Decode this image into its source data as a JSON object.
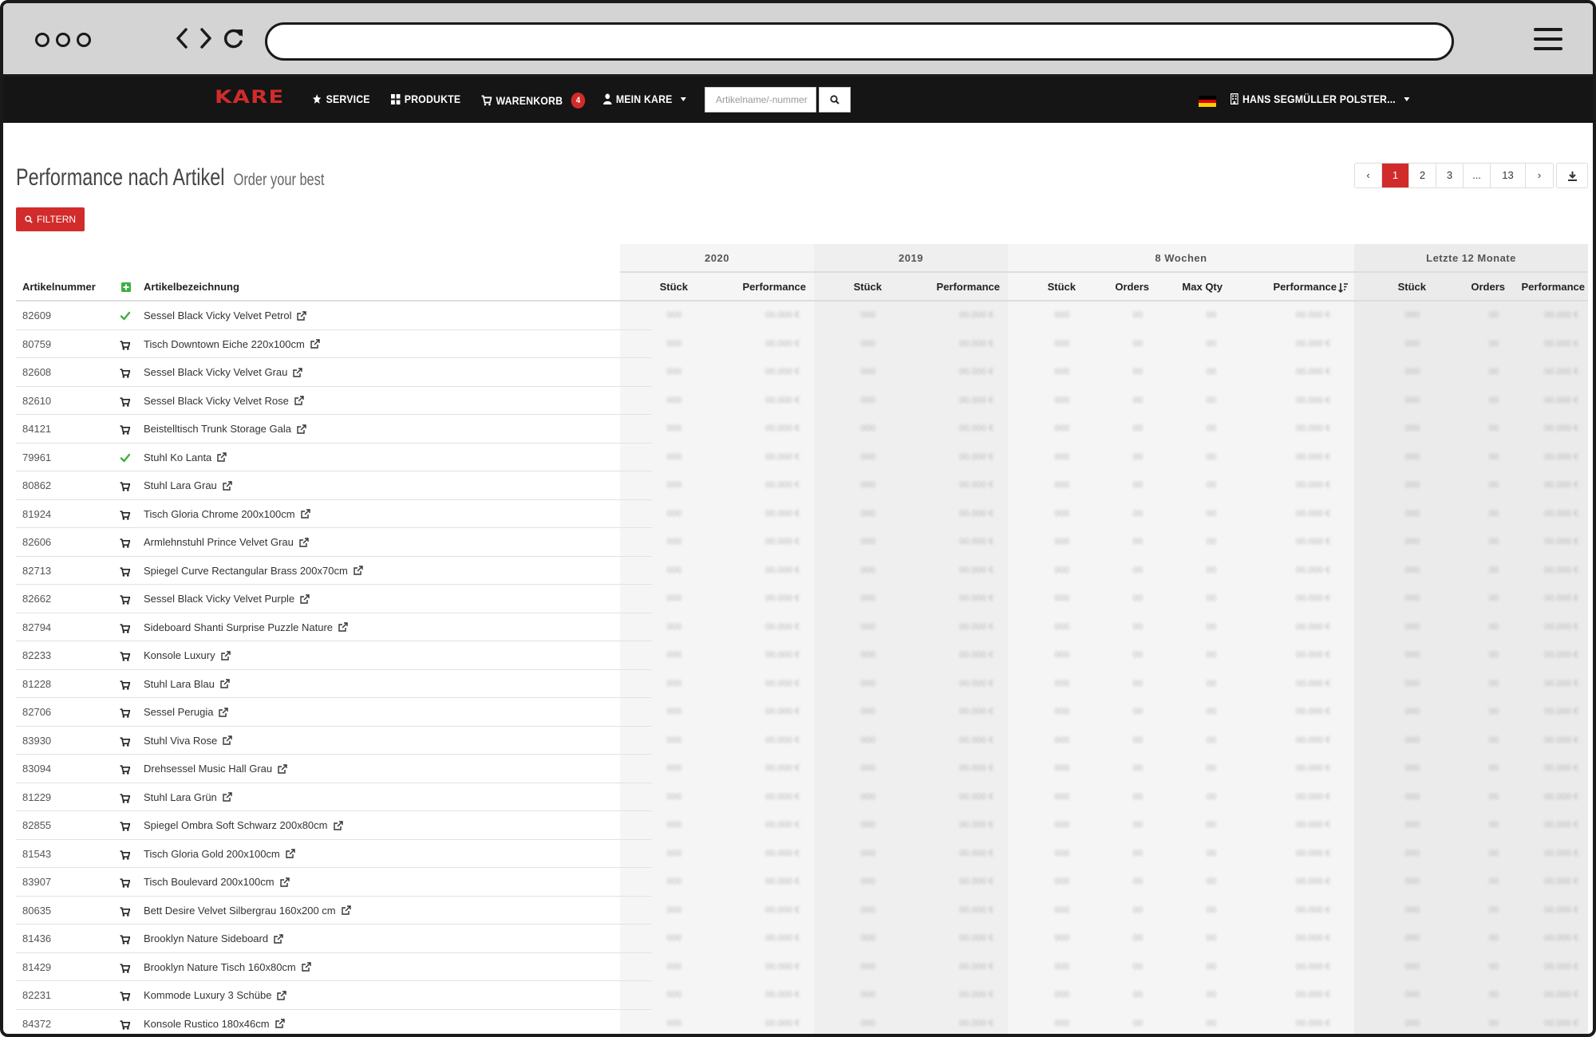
{
  "browser": {
    "url": "",
    "icons": [
      "window-dots",
      "back-icon",
      "forward-icon",
      "reload-icon",
      "hamburger-icon"
    ]
  },
  "nav": {
    "logo": "KARE",
    "service": "SERVICE",
    "produkte": "PRODUKTE",
    "warenkorb": "WARENKORB",
    "cart_count": "4",
    "mein_kare": "MEIN KARE",
    "search_placeholder": "Artikelname/-nummer",
    "account": "HANS SEGMÜLLER POLSTER...",
    "accent_color": "#d22b2b"
  },
  "page": {
    "title": "Performance nach Artikel",
    "subtitle": "Order your best",
    "filter_label": "FILTERN"
  },
  "pager": {
    "prev": "‹",
    "pages": [
      "1",
      "2",
      "3",
      "...",
      "13"
    ],
    "active": "1",
    "next": "›"
  },
  "table": {
    "groups": [
      "2020",
      "2019",
      "8 Wochen",
      "Letzte 12 Monate"
    ],
    "headers": {
      "artikelnummer": "Artikelnummer",
      "artikelbezeichnung": "Artikelbezeichnung",
      "s2020_stueck": "Stück",
      "s2020_perf": "Performance",
      "s2019_stueck": "Stück",
      "s2019_perf": "Performance",
      "w8_stueck": "Stück",
      "w8_orders": "Orders",
      "w8_maxqty": "Max Qty",
      "w8_perf": "Performance",
      "m12_stueck": "Stück",
      "m12_orders": "Orders",
      "m12_perf": "Performance"
    },
    "rows": [
      {
        "nr": "82609",
        "name": "Sessel Black Vicky Velvet Petrol",
        "status": "check"
      },
      {
        "nr": "80759",
        "name": "Tisch Downtown Eiche 220x100cm",
        "status": "cart"
      },
      {
        "nr": "82608",
        "name": "Sessel Black Vicky Velvet Grau",
        "status": "cart"
      },
      {
        "nr": "82610",
        "name": "Sessel Black Vicky Velvet Rose",
        "status": "cart"
      },
      {
        "nr": "84121",
        "name": "Beistelltisch Trunk Storage Gala",
        "status": "cart"
      },
      {
        "nr": "79961",
        "name": "Stuhl Ko Lanta",
        "status": "check"
      },
      {
        "nr": "80862",
        "name": "Stuhl Lara Grau",
        "status": "cart"
      },
      {
        "nr": "81924",
        "name": "Tisch Gloria Chrome 200x100cm",
        "status": "cart"
      },
      {
        "nr": "82606",
        "name": "Armlehnstuhl Prince Velvet Grau",
        "status": "cart"
      },
      {
        "nr": "82713",
        "name": "Spiegel Curve Rectangular Brass 200x70cm",
        "status": "cart"
      },
      {
        "nr": "82662",
        "name": "Sessel Black Vicky Velvet Purple",
        "status": "cart"
      },
      {
        "nr": "82794",
        "name": "Sideboard Shanti Surprise Puzzle Nature",
        "status": "cart"
      },
      {
        "nr": "82233",
        "name": "Konsole Luxury",
        "status": "cart"
      },
      {
        "nr": "81228",
        "name": "Stuhl Lara Blau",
        "status": "cart"
      },
      {
        "nr": "82706",
        "name": "Sessel Perugia",
        "status": "cart"
      },
      {
        "nr": "83930",
        "name": "Stuhl Viva Rose",
        "status": "cart"
      },
      {
        "nr": "83094",
        "name": "Drehsessel Music Hall Grau",
        "status": "cart"
      },
      {
        "nr": "81229",
        "name": "Stuhl Lara Grün",
        "status": "cart"
      },
      {
        "nr": "82855",
        "name": "Spiegel Ombra Soft Schwarz 200x80cm",
        "status": "cart"
      },
      {
        "nr": "81543",
        "name": "Tisch Gloria Gold 200x100cm",
        "status": "cart"
      },
      {
        "nr": "83907",
        "name": "Tisch Boulevard 200x100cm",
        "status": "cart"
      },
      {
        "nr": "80635",
        "name": "Bett Desire Velvet Silbergrau 160x200 cm",
        "status": "cart"
      },
      {
        "nr": "81436",
        "name": "Brooklyn Nature Sideboard",
        "status": "cart"
      },
      {
        "nr": "81429",
        "name": "Brooklyn Nature Tisch 160x80cm",
        "status": "cart"
      },
      {
        "nr": "82231",
        "name": "Kommode Luxury 3 Schübe",
        "status": "cart"
      },
      {
        "nr": "84372",
        "name": "Konsole Rustico 180x46cm",
        "status": "cart"
      }
    ]
  }
}
